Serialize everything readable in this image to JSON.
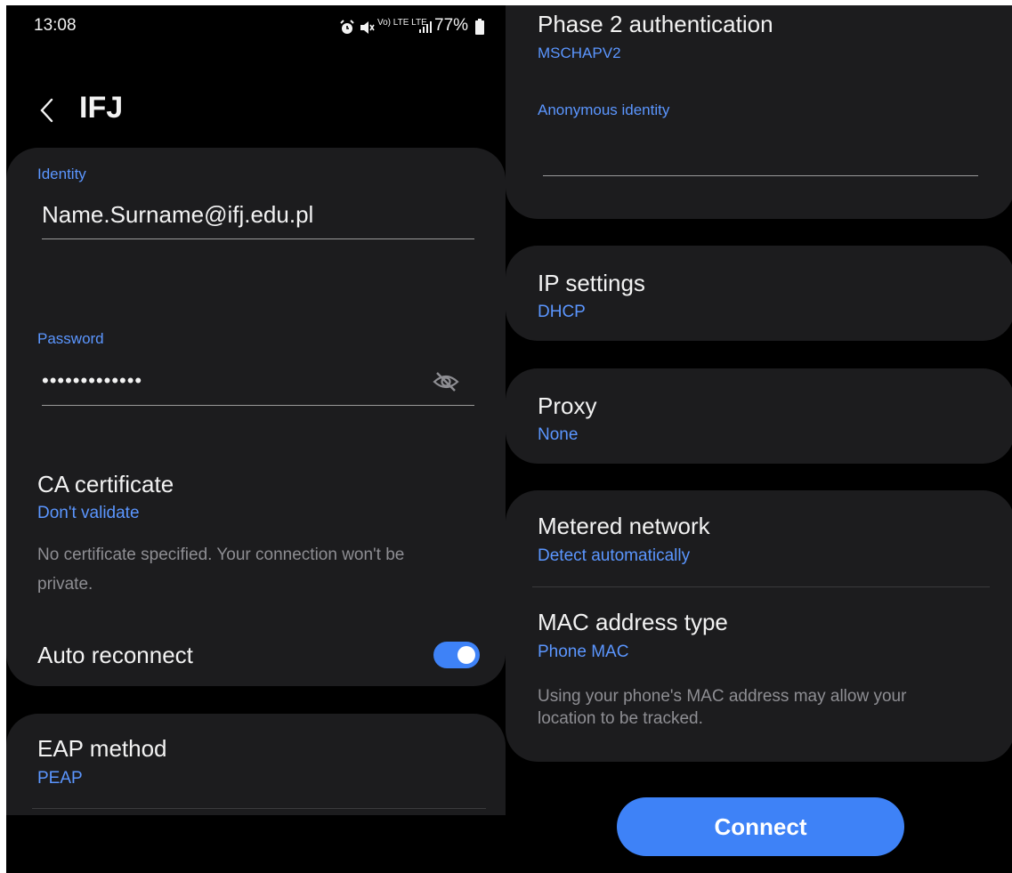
{
  "status_bar": {
    "time": "13:08",
    "signal_text": "Vo) LTE LTE",
    "battery": "77%"
  },
  "header": {
    "title": "IFJ"
  },
  "identity": {
    "label": "Identity",
    "value": "Name.Surname@ifj.edu.pl"
  },
  "password": {
    "label": "Password",
    "value": "•••••••••••••"
  },
  "ca_certificate": {
    "title": "CA certificate",
    "value": "Don't validate",
    "note_line1": "No certificate specified. Your connection won't be",
    "note_line2": "private."
  },
  "auto_reconnect": {
    "label": "Auto reconnect",
    "enabled": true
  },
  "eap_method": {
    "title": "EAP method",
    "value": "PEAP"
  },
  "phase2": {
    "title": "Phase 2 authentication",
    "value": "MSCHAPV2"
  },
  "anonymous_identity": {
    "label": "Anonymous identity",
    "value": ""
  },
  "ip_settings": {
    "title": "IP settings",
    "value": "DHCP"
  },
  "proxy": {
    "title": "Proxy",
    "value": "None"
  },
  "metered_network": {
    "title": "Metered network",
    "value": "Detect automatically"
  },
  "mac_address": {
    "title": "MAC address type",
    "value": "Phone MAC",
    "note_line1": "Using your phone's MAC address may allow your",
    "note_line2": "location to be tracked."
  },
  "connect_label": "Connect",
  "colors": {
    "accent": "#3e82f7",
    "link": "#5b96ff",
    "card": "#1c1c1e",
    "background": "#000000"
  },
  "icons": [
    "back-arrow-icon",
    "alarm-icon",
    "mute-icon",
    "signal-icon",
    "battery-icon",
    "eye-off-icon"
  ]
}
